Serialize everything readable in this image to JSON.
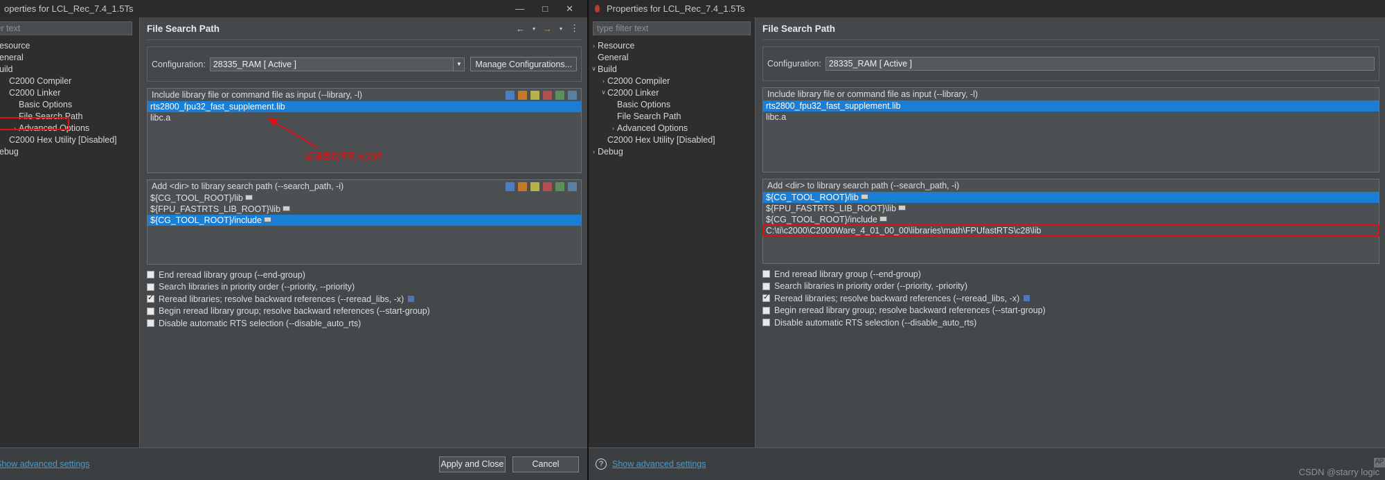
{
  "left_window": {
    "title": "operties for LCL_Rec_7.4_1.5Ts",
    "window_controls": {
      "minimize": "—",
      "maximize": "□",
      "close": "✕"
    },
    "filter_placeholder": "filter text",
    "tree": [
      {
        "label": "esource",
        "arrow": "",
        "indent": 0,
        "highlight": false
      },
      {
        "label": "eneral",
        "arrow": "",
        "indent": 0,
        "highlight": false
      },
      {
        "label": "uild",
        "arrow": "",
        "indent": 0,
        "highlight": false
      },
      {
        "label": "C2000 Compiler",
        "arrow": "",
        "indent": 1,
        "highlight": false
      },
      {
        "label": "C2000 Linker",
        "arrow": "",
        "indent": 1,
        "highlight": false
      },
      {
        "label": "Basic Options",
        "arrow": "",
        "indent": 2,
        "highlight": false
      },
      {
        "label": "File Search Path",
        "arrow": "",
        "indent": 2,
        "highlight": true
      },
      {
        "label": "Advanced Options",
        "arrow": "›",
        "indent": 2,
        "highlight": false
      },
      {
        "label": "C2000 Hex Utility  [Disabled]",
        "arrow": "",
        "indent": 1,
        "highlight": false
      },
      {
        "label": "ebug",
        "arrow": "",
        "indent": 0,
        "highlight": false
      }
    ],
    "page_title": "File Search Path",
    "nav": {
      "back": "←",
      "forward_down": "▾",
      "forward": "→",
      "forward_caret": "▾",
      "menu": "⋮"
    },
    "configuration_label": "Configuration:",
    "configuration_value": "28335_RAM  [ Active ]",
    "manage_button": "Manage Configurations...",
    "library_list": {
      "header": "Include library file or command file as input (--library, -l)",
      "items": [
        {
          "text": "rts2800_fpu32_fast_supplement.lib",
          "selected": true,
          "var": false
        },
        {
          "text": "libc.a",
          "selected": false,
          "var": false
        }
      ]
    },
    "search_path_list": {
      "header": "Add <dir> to library search path (--search_path, -i)",
      "items": [
        {
          "text": "${CG_TOOL_ROOT}/lib",
          "selected": false,
          "var": true
        },
        {
          "text": "${FPU_FASTRTS_LIB_ROOT}\\lib",
          "selected": false,
          "var": true
        },
        {
          "text": "${CG_TOOL_ROOT}/include",
          "selected": true,
          "var": true
        }
      ]
    },
    "checkboxes": [
      {
        "label": "End reread library group (--end-group)",
        "checked": false,
        "info": false
      },
      {
        "label": "Search libraries in priority order (--priority, --priority)",
        "checked": false,
        "info": false
      },
      {
        "label": "Reread libraries; resolve backward references (--reread_libs, -x)",
        "checked": true,
        "info": true
      },
      {
        "label": "Begin reread library group; resolve backward references (--start-group)",
        "checked": false,
        "info": false
      },
      {
        "label": "Disable automatic RTS selection (--disable_auto_rts)",
        "checked": false,
        "info": false
      }
    ],
    "advanced_link": "Show advanced settings",
    "apply_button": "Apply and Close",
    "cancel_button": "Cancel",
    "annotation": "编译器找不到该文件"
  },
  "right_window": {
    "title": "Properties for LCL_Rec_7.4_1.5Ts",
    "filter_placeholder": "type filter text",
    "tree": [
      {
        "label": "Resource",
        "arrow": "›",
        "indent": 0
      },
      {
        "label": "General",
        "arrow": "",
        "indent": 0
      },
      {
        "label": "Build",
        "arrow": "∨",
        "indent": 0
      },
      {
        "label": "C2000 Compiler",
        "arrow": "›",
        "indent": 1
      },
      {
        "label": "C2000 Linker",
        "arrow": "∨",
        "indent": 1
      },
      {
        "label": "Basic Options",
        "arrow": "",
        "indent": 2
      },
      {
        "label": "File Search Path",
        "arrow": "",
        "indent": 2
      },
      {
        "label": "Advanced Options",
        "arrow": "›",
        "indent": 2
      },
      {
        "label": "C2000 Hex Utility  [Disabled]",
        "arrow": "",
        "indent": 1
      },
      {
        "label": "Debug",
        "arrow": "›",
        "indent": 0
      }
    ],
    "page_title": "File Search Path",
    "configuration_label": "Configuration:",
    "configuration_value": "28335_RAM  [ Active ]",
    "library_list": {
      "header": "Include library file or command file as input (--library, -l)",
      "items": [
        {
          "text": "rts2800_fpu32_fast_supplement.lib",
          "selected": true,
          "var": false
        },
        {
          "text": "libc.a",
          "selected": false,
          "var": false
        }
      ]
    },
    "search_path_list": {
      "header": "Add <dir> to library search path (--search_path, -i)",
      "items": [
        {
          "text": "${CG_TOOL_ROOT}/lib",
          "selected": true,
          "var": true,
          "boxed": false
        },
        {
          "text": "${FPU_FASTRTS_LIB_ROOT}\\lib",
          "selected": false,
          "var": true,
          "boxed": false
        },
        {
          "text": "${CG_TOOL_ROOT}/include",
          "selected": false,
          "var": true,
          "boxed": false
        },
        {
          "text": "C:\\ti\\c2000\\C2000Ware_4_01_00_00\\libraries\\math\\FPUfastRTS\\c28\\lib",
          "selected": false,
          "var": false,
          "boxed": true
        }
      ]
    },
    "checkboxes": [
      {
        "label": "End reread library group (--end-group)",
        "checked": false,
        "info": false
      },
      {
        "label": "Search libraries in priority order (--priority, -priority)",
        "checked": false,
        "info": false
      },
      {
        "label": "Reread libraries; resolve backward references (--reread_libs, -x)",
        "checked": true,
        "info": true
      },
      {
        "label": "Begin reread library group; resolve backward references (--start-group)",
        "checked": false,
        "info": false
      },
      {
        "label": "Disable automatic RTS selection (--disable_auto_rts)",
        "checked": false,
        "info": false
      }
    ],
    "advanced_link": "Show advanced settings",
    "scroll_corner": "AP"
  },
  "watermark": "CSDN @starry logic",
  "colors": {
    "selection_blue": "#1a7fd4",
    "annotation_red": "#e01010",
    "link_blue": "#3a9fd8",
    "panel_bg": "#44484a",
    "tree_bg": "#2e2e2e"
  }
}
